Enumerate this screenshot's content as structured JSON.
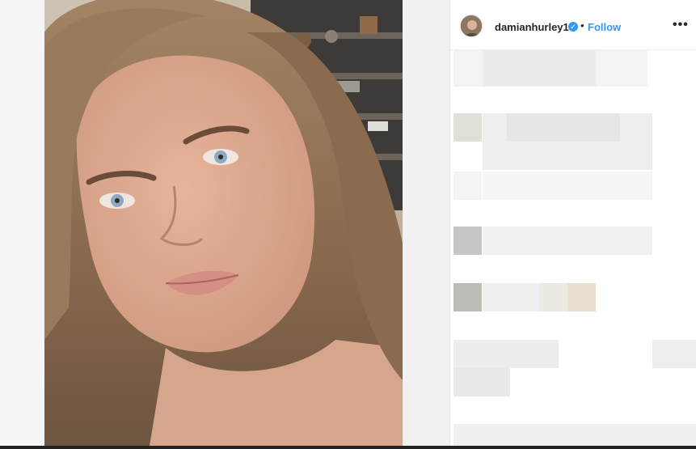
{
  "post": {
    "username": "damianhurley1",
    "separator": "•",
    "follow_label": "Follow",
    "more_label": "•••",
    "verified_glyph": "✓"
  },
  "icons": {
    "avatar": "profile-avatar",
    "verified": "verified-badge-icon",
    "more": "more-options-icon"
  },
  "colors": {
    "link_blue": "#3897f0",
    "text_dark": "#262626"
  }
}
